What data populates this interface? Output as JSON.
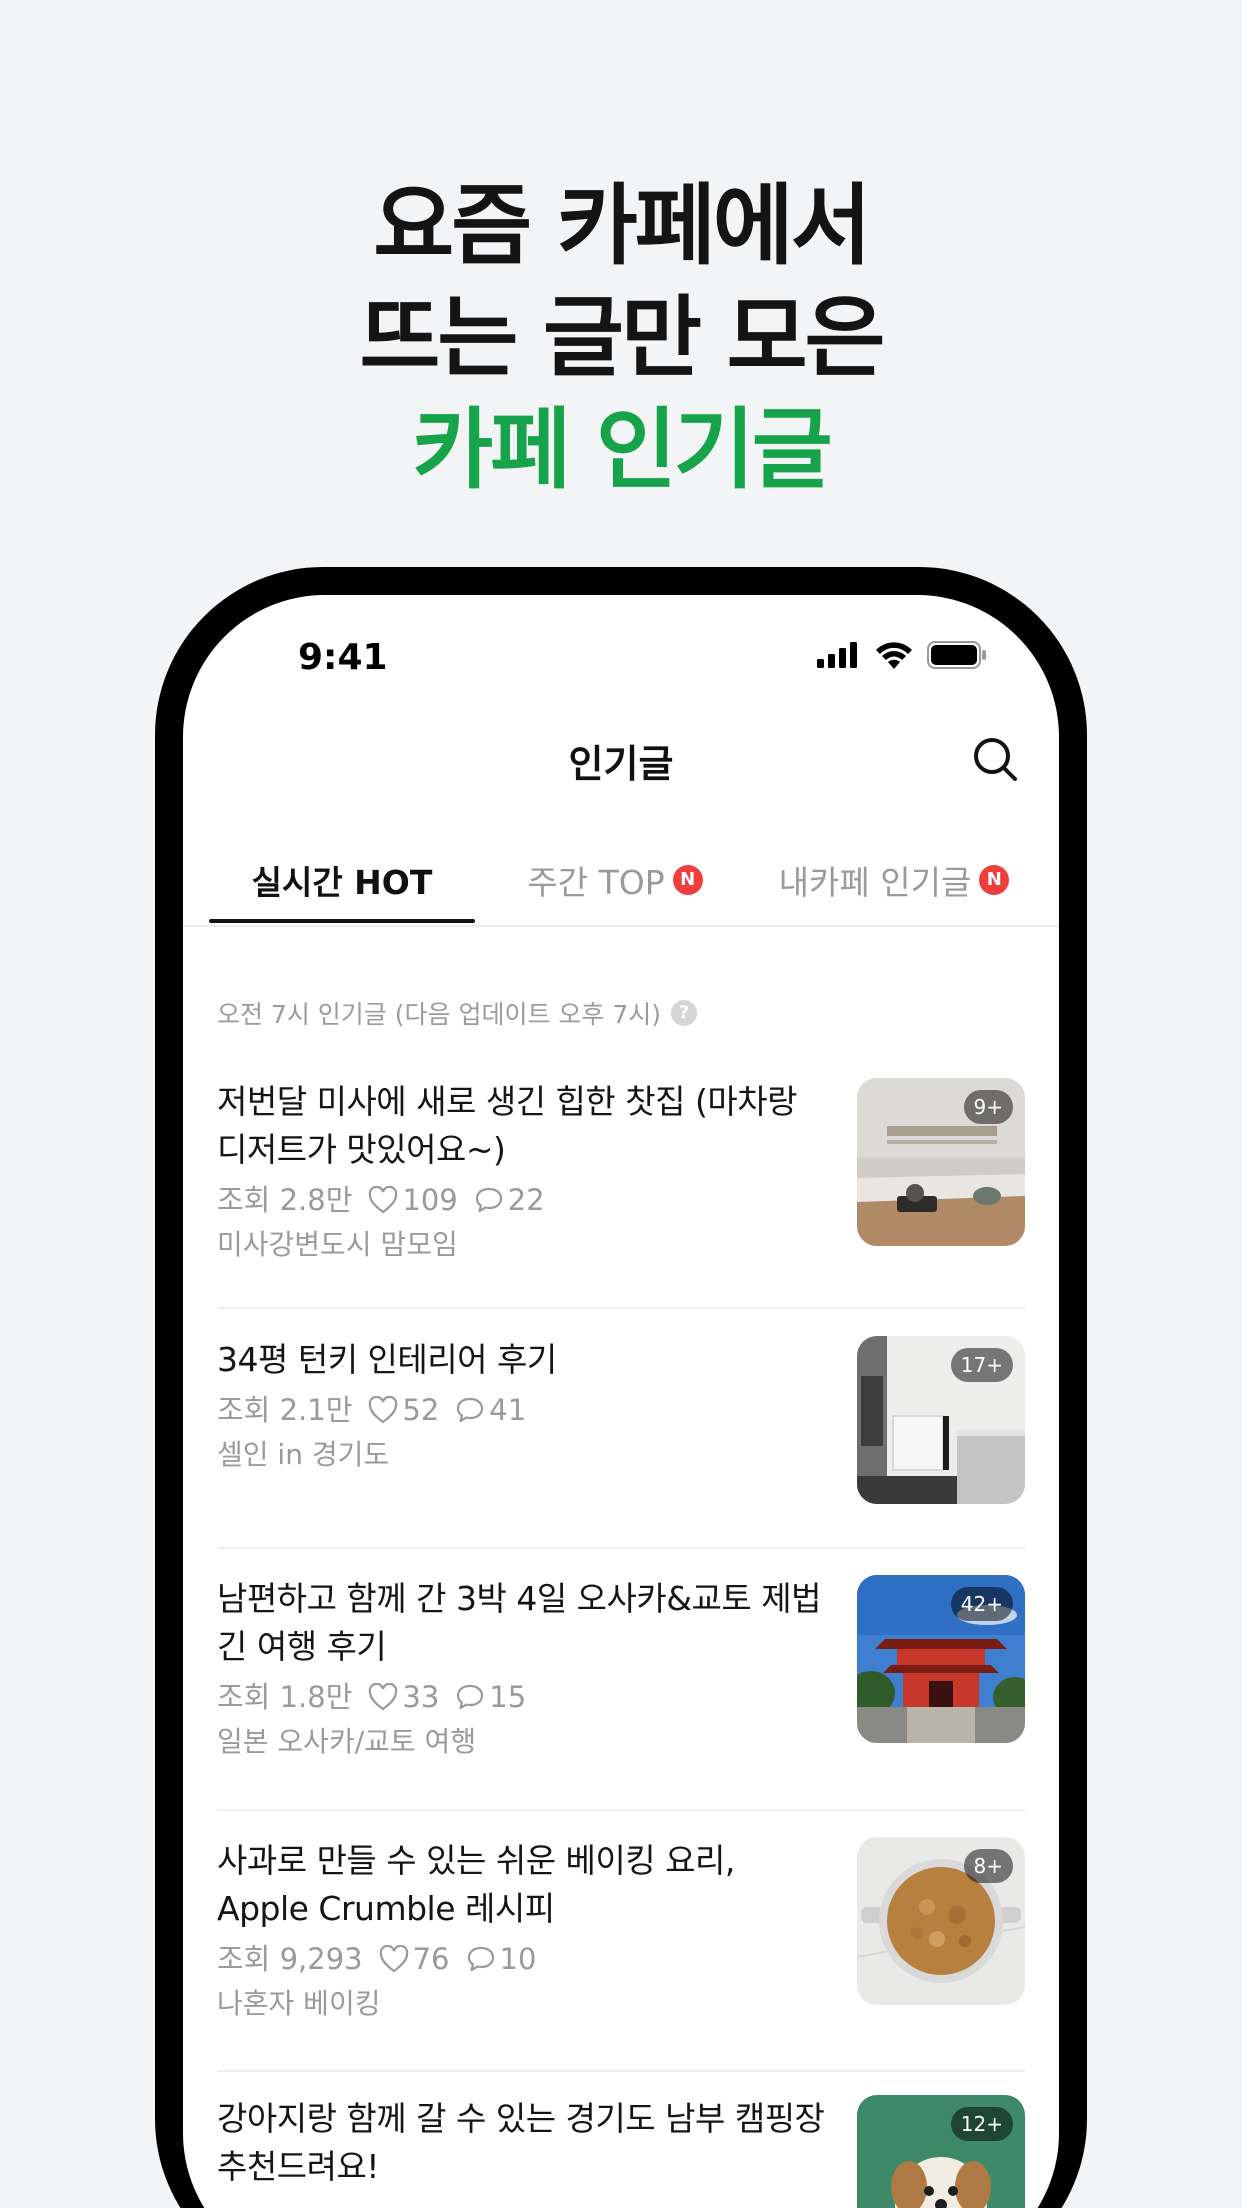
{
  "headline": {
    "line1": "요즘 카페에서",
    "line2": "뜨는 글만 모은",
    "line3": "카페 인기글"
  },
  "status_bar": {
    "time": "9:41"
  },
  "header": {
    "title": "인기글",
    "search_icon": "search-icon"
  },
  "tabs": [
    {
      "label": "실시간 HOT",
      "active": true,
      "badge": ""
    },
    {
      "label": "주간 TOP",
      "active": false,
      "badge": "N"
    },
    {
      "label": "내카페 인기글",
      "active": false,
      "badge": "N"
    }
  ],
  "notice": "오전 7시 인기글 (다음 업데이트 오후 7시)",
  "posts": [
    {
      "title_line1": "저번달 미사에 새로 생긴 힙한 찻집 (마차랑",
      "title_line2": "디저트가 맛있어요~)",
      "views": "조회 2.8만",
      "likes": "109",
      "comments": "22",
      "cafe": "미사강변도시 맘모임",
      "image_count": "9+"
    },
    {
      "title_line1": "34평 턴키 인테리어 후기",
      "title_line2": "",
      "views": "조회 2.1만",
      "likes": "52",
      "comments": "41",
      "cafe": "셀인 in 경기도",
      "image_count": "17+"
    },
    {
      "title_line1": "남편하고 함께 간 3박 4일 오사카&교토 제법",
      "title_line2": "긴 여행 후기",
      "views": "조회 1.8만",
      "likes": "33",
      "comments": "15",
      "cafe": "일본 오사카/교토 여행",
      "image_count": "42+"
    },
    {
      "title_line1": "사과로 만들 수 있는 쉬운 베이킹 요리,",
      "title_line2": "Apple Crumble 레시피",
      "views": "조회 9,293",
      "likes": "76",
      "comments": "10",
      "cafe": "나혼자 베이킹",
      "image_count": "8+"
    },
    {
      "title_line1": "강아지랑 함께 갈 수 있는 경기도 남부 캠핑장",
      "title_line2": "추천드려요!",
      "views": "",
      "likes": "",
      "comments": "",
      "cafe": "",
      "image_count": "12+"
    }
  ],
  "colors": {
    "accent": "#16a34a",
    "badge": "#f03e3e"
  }
}
